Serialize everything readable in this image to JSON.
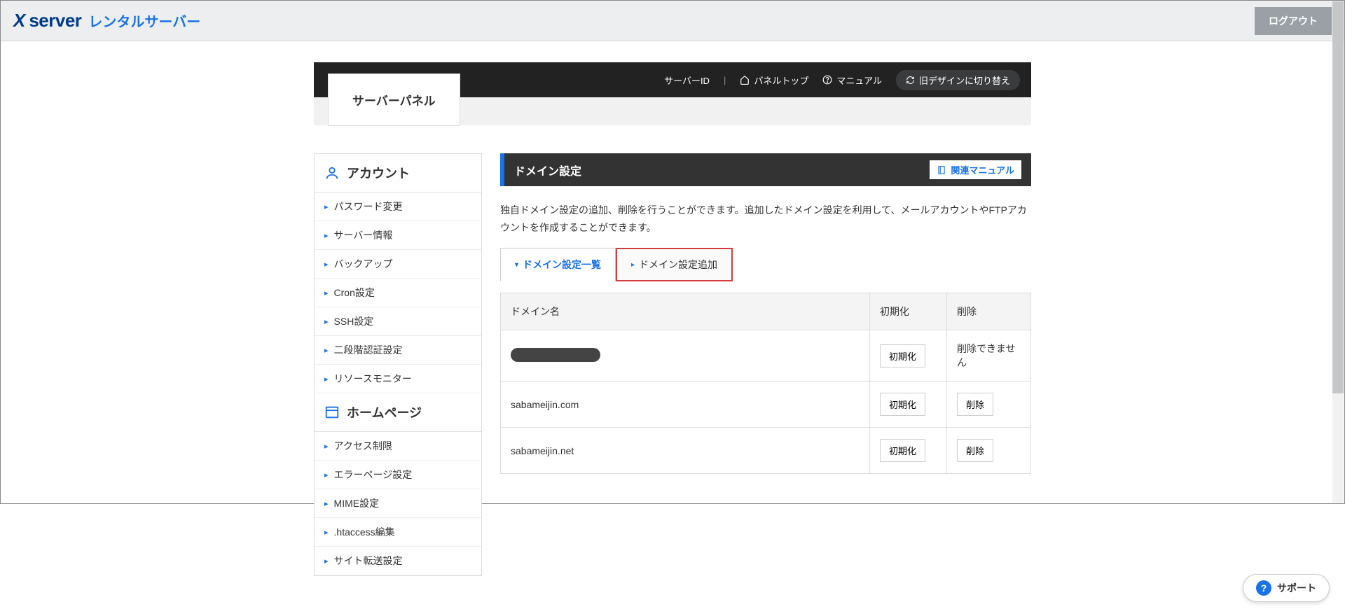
{
  "topbar": {
    "brand_x": "X",
    "brand_server": "server",
    "brand_sub": "レンタルサーバー",
    "logout": "ログアウト"
  },
  "panel_badge": "サーバーパネル",
  "blackbar": {
    "server_id_label": "サーバーID",
    "panel_top": "パネルトップ",
    "manual": "マニュアル",
    "old_design": "旧デザインに切り替え"
  },
  "sidebar": {
    "section_account": "アカウント",
    "account_items": [
      "パスワード変更",
      "サーバー情報",
      "バックアップ",
      "Cron設定",
      "SSH設定",
      "二段階認証設定",
      "リソースモニター"
    ],
    "section_homepage": "ホームページ",
    "homepage_items": [
      "アクセス制限",
      "エラーページ設定",
      "MIME設定",
      ".htaccess編集",
      "サイト転送設定"
    ]
  },
  "main": {
    "title": "ドメイン設定",
    "manual_chip": "関連マニュアル",
    "desc": "独自ドメイン設定の追加、削除を行うことができます。追加したドメイン設定を利用して、メールアカウントやFTPアカウントを作成することができます。",
    "tab_list": "ドメイン設定一覧",
    "tab_add": "ドメイン設定追加",
    "th_domain": "ドメイン名",
    "th_init": "初期化",
    "th_del": "削除",
    "rows": [
      {
        "domain": "",
        "masked": true,
        "init": "初期化",
        "del": "削除できません",
        "del_disabled": true
      },
      {
        "domain": "sabameijin.com",
        "masked": false,
        "init": "初期化",
        "del": "削除",
        "del_disabled": false
      },
      {
        "domain": "sabameijin.net",
        "masked": false,
        "init": "初期化",
        "del": "削除",
        "del_disabled": false
      }
    ]
  },
  "support": "サポート"
}
